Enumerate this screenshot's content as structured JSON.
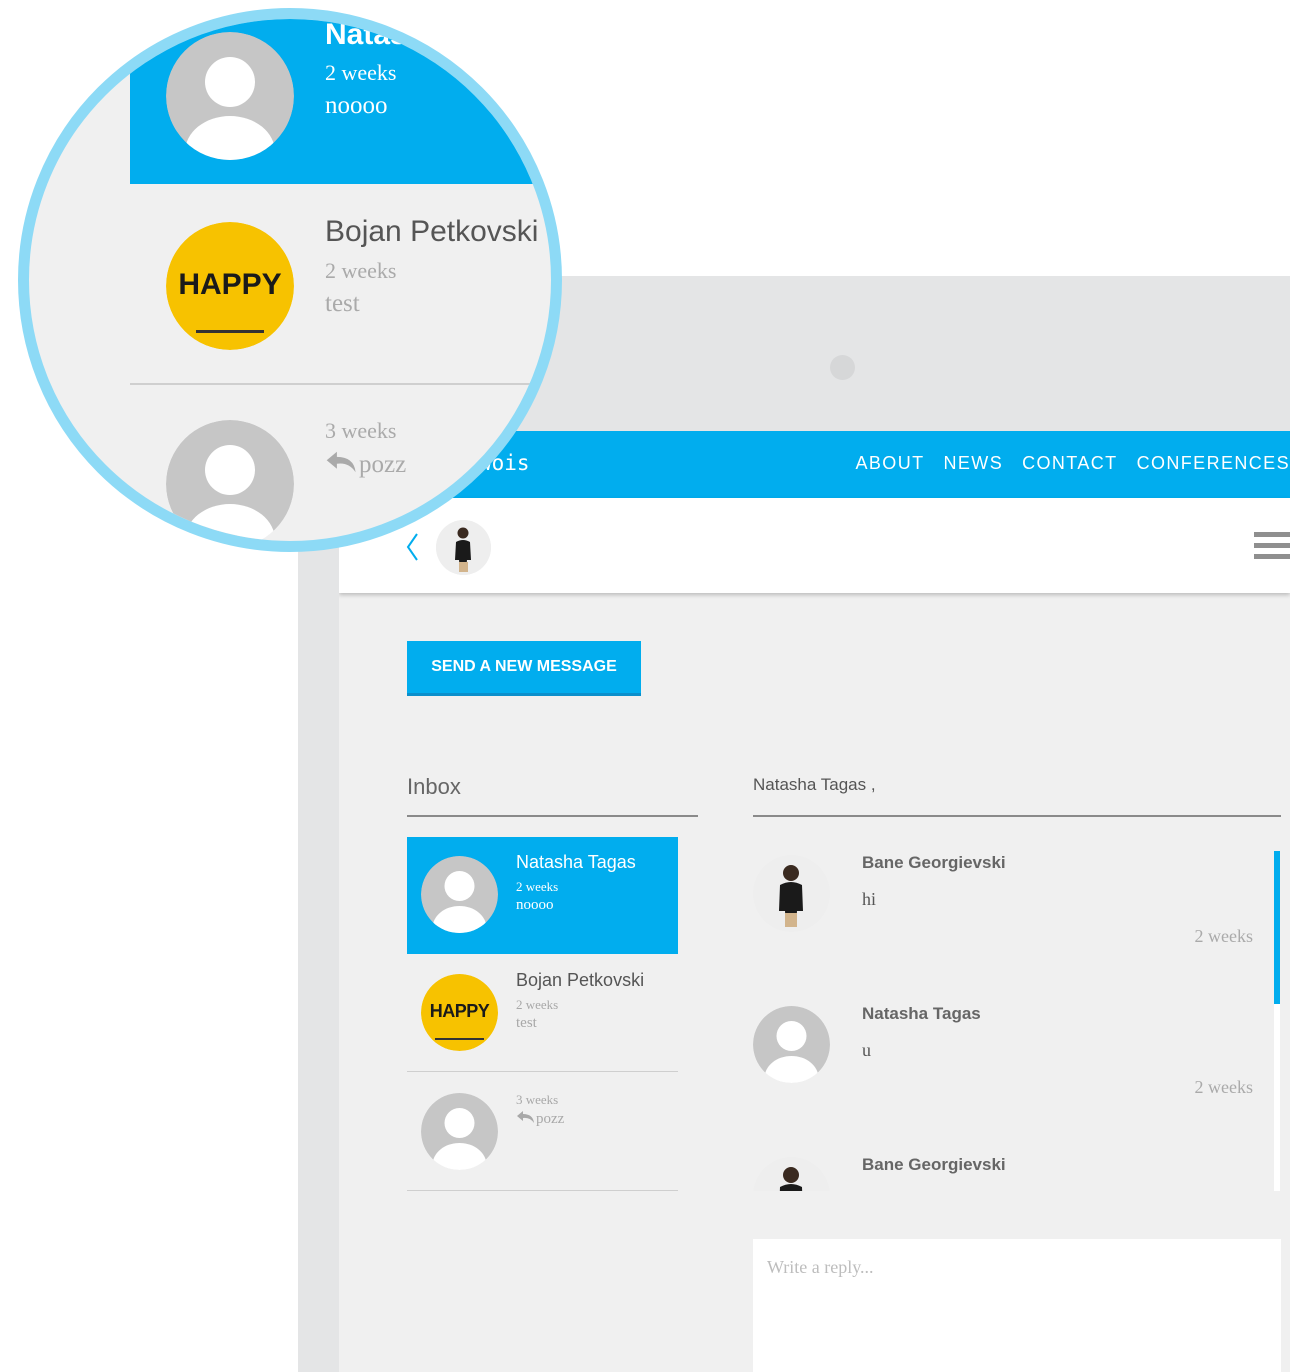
{
  "nav": {
    "brand_fragment": "wois",
    "links": [
      "ABOUT",
      "NEWS",
      "CONTACT",
      "CONFERENCES"
    ]
  },
  "send_button_label": "SEND A NEW MESSAGE",
  "inbox": {
    "title": "Inbox",
    "threads": [
      {
        "name": "Natasha Tagas",
        "time": "2 weeks",
        "message": "noooo",
        "avatar": "default-avatar",
        "active": true
      },
      {
        "name": "Bojan Petkovski",
        "time": "2 weeks",
        "message": "test",
        "avatar": "happy-logo",
        "avatar_text": "HAPPY"
      },
      {
        "name": "",
        "time": "3 weeks",
        "message": "pozz",
        "avatar": "default-avatar",
        "replied": true
      }
    ]
  },
  "conversation": {
    "title": "Natasha Tagas ,",
    "messages": [
      {
        "author": "Bane Georgievski",
        "text": "hi",
        "time": "2 weeks"
      },
      {
        "author": "Natasha Tagas",
        "text": "u",
        "time": "2 weeks"
      },
      {
        "author": "Bane Georgievski",
        "text": "",
        "time": ""
      }
    ]
  },
  "reply_placeholder": "Write a reply...",
  "magnifier": {
    "thread_0_name": "Natas",
    "thread_0_time": "2 weeks",
    "thread_0_message": "noooo",
    "thread_1_name": "Bojan Petkovski",
    "thread_1_time": "2 weeks",
    "thread_1_message": "test",
    "thread_1_avatar_text": "HAPPY",
    "thread_2_time": "3 weeks",
    "thread_2_message": "pozz"
  },
  "colors": {
    "accent": "#01adee",
    "highlight_ring": "#8ddaf6",
    "background": "#f0f0f0",
    "happy_yellow": "#f7c200"
  }
}
